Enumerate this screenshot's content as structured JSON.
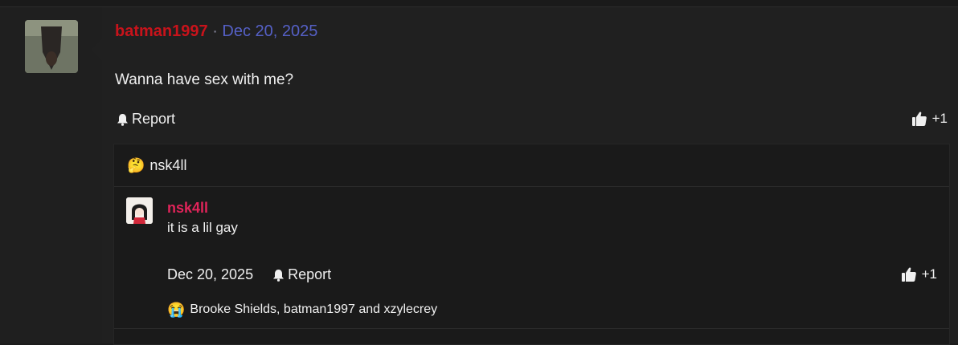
{
  "post": {
    "author": "batman1997",
    "separator": "·",
    "date": "Dec 20, 2025",
    "message": "Wanna have sex with me?",
    "report_label": "Report",
    "like_count": "+1"
  },
  "reply_thread": {
    "header_emoji": "🤔",
    "header_user": "nsk4ll",
    "reply": {
      "author": "nsk4ll",
      "text": "it is a lil gay",
      "date": "Dec 20, 2025",
      "report_label": "Report",
      "like_count": "+1",
      "reaction_emoji": "😭",
      "reactors": "Brooke Shields, batman1997 and xzylecrey"
    }
  },
  "colors": {
    "author_name": "#c8131b",
    "date_link": "#5560c6",
    "reply_author": "#e1245a"
  }
}
